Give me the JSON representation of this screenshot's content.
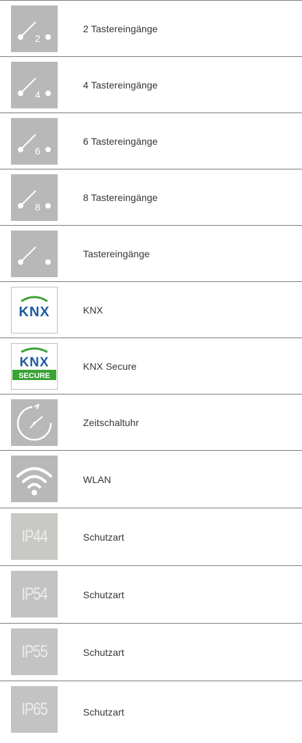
{
  "items": [
    {
      "icon": "switch-2-icon",
      "digit": "2",
      "label": "2 Tastereingänge"
    },
    {
      "icon": "switch-4-icon",
      "digit": "4",
      "label": "4 Tastereingänge"
    },
    {
      "icon": "switch-6-icon",
      "digit": "6",
      "label": "6 Tastereingänge"
    },
    {
      "icon": "switch-8-icon",
      "digit": "8",
      "label": "8 Tastereingänge"
    },
    {
      "icon": "switch-icon",
      "label": "Tastereingänge"
    },
    {
      "icon": "knx-logo-icon",
      "logo_text": "KNX",
      "label": "KNX"
    },
    {
      "icon": "knx-secure-logo-icon",
      "logo_text": "KNX",
      "badge_text": "SECURE",
      "label": "KNX Secure"
    },
    {
      "icon": "timer-clock-icon",
      "label": "Zeitschaltuhr"
    },
    {
      "icon": "wifi-icon",
      "label": "WLAN"
    },
    {
      "icon": "ip44-icon",
      "badge_text": "IP44",
      "label": "Schutzart"
    },
    {
      "icon": "ip54-icon",
      "badge_text": "IP54",
      "label": "Schutzart"
    },
    {
      "icon": "ip55-icon",
      "badge_text": "IP55",
      "label": "Schutzart"
    },
    {
      "icon": "ip65-icon",
      "badge_text": "IP65",
      "label": "Schutzart"
    }
  ],
  "colors": {
    "icon_bg": "#b8b8b8",
    "knx_blue": "#1d5a9e",
    "knx_green": "#3aa335",
    "divider": "#7a7a7a",
    "text": "#333333"
  }
}
